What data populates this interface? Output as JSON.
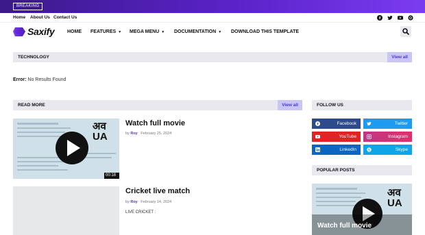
{
  "topbar": {
    "breaking_label": "BREAKING"
  },
  "secnav": {
    "items": [
      "Home",
      "About Us",
      "Contact Us"
    ]
  },
  "social_top": [
    "facebook-icon",
    "twitter-icon",
    "youtube-icon",
    "instagram-icon"
  ],
  "header": {
    "logo_text": "Saxify",
    "nav": [
      {
        "label": "HOME",
        "dropdown": false
      },
      {
        "label": "FEATURES",
        "dropdown": true
      },
      {
        "label": "MEGA MENU",
        "dropdown": true
      },
      {
        "label": "DOCUMENTATION",
        "dropdown": true
      },
      {
        "label": "DOWNLOAD THIS TEMPLATE",
        "dropdown": false
      }
    ]
  },
  "technology": {
    "title": "TECHNOLOGY",
    "view_all": "View all",
    "error_label": "Error:",
    "error_text": "No Results Found"
  },
  "read_more": {
    "title": "READ MORE",
    "view_all": "View all",
    "posts": [
      {
        "title": "Watch full movie",
        "by": "by",
        "author": "Roy",
        "date": "February 25, 2024",
        "duration": "00:18",
        "thumb_text": "अव UA",
        "excerpt": ""
      },
      {
        "title": "Cricket live match",
        "by": "by",
        "author": "Roy",
        "date": "February 14, 2024",
        "excerpt": "LIVE CRICKET :"
      }
    ]
  },
  "follow_us": {
    "title": "FOLLOW US",
    "items": [
      {
        "label": "Facebook",
        "icon": "facebook-icon",
        "color": "#2d4a8a"
      },
      {
        "label": "Twitter",
        "icon": "twitter-icon",
        "color": "#1d9bf0"
      },
      {
        "label": "YouTube",
        "icon": "youtube-icon",
        "color": "#e02424"
      },
      {
        "label": "Instagram",
        "icon": "instagram-icon",
        "color": "#d2357a"
      },
      {
        "label": "LinkedIn",
        "icon": "linkedin-icon",
        "color": "#0a66c2"
      },
      {
        "label": "Skype",
        "icon": "skype-icon",
        "color": "#0ea5e9"
      }
    ]
  },
  "popular_posts": {
    "title": "POPULAR POSTS",
    "first_post_title": "Watch full movie",
    "thumb_text": "अव UA"
  },
  "colors": {
    "accent": "#4a3bc7",
    "topbar": "#5a22c8"
  }
}
